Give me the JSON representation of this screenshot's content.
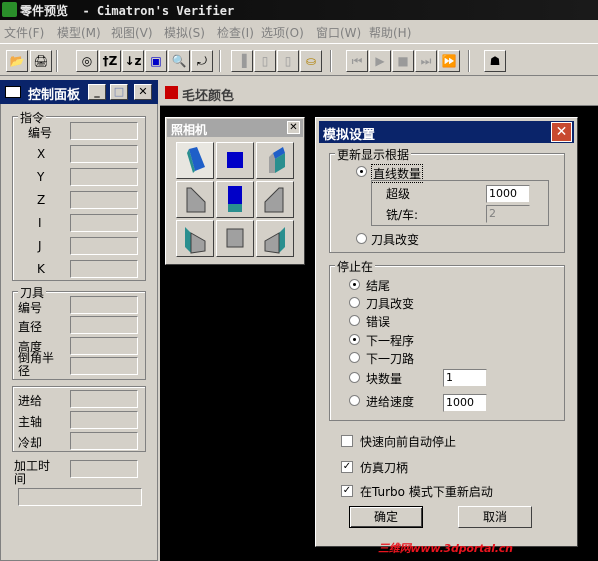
{
  "window": {
    "title": "零件预览  - Cimatron's Verifier"
  },
  "menu": [
    "文件(F)",
    "模型(M)",
    "视图(V)",
    "模拟(S)",
    "检查(I)",
    "选项(O)",
    "窗口(W)",
    "帮助(H)"
  ],
  "toolbar": {
    "buttons": [
      "open",
      "print",
      "camera",
      "zoom-t",
      "zoom-l",
      "box",
      "magnify",
      "rotate",
      "tool1",
      "tool2",
      "tool3",
      "stock",
      "rewind",
      "play",
      "stop",
      "step",
      "fast-forward",
      "robot"
    ],
    "glyphs": {
      "open": "📂",
      "print": "🖨",
      "camera": "◎",
      "zoom_t": "†Z",
      "zoom_l": "↓z",
      "box": "▣",
      "magnify": "🔍",
      "rotate": "⤾",
      "rewind": "⏮",
      "play": "▶",
      "stop": "■",
      "step": "⏭",
      "ffwd": "⏩",
      "robot": "☗"
    }
  },
  "control_panel": {
    "title": "控制面板",
    "instruction_group": {
      "label": "指令",
      "rows": [
        "编号",
        "X",
        "Y",
        "Z",
        "I",
        "J",
        "K"
      ]
    },
    "tool_group": {
      "label": "刀具",
      "rows": [
        "编号",
        "直径",
        "高度",
        "倒角半径"
      ]
    },
    "motion_group": {
      "rows": [
        "进给",
        "主轴",
        "冷却"
      ]
    },
    "time_label": "加工时间"
  },
  "workspace": {
    "title": "毛坯颜色"
  },
  "camera": {
    "title": "照相机"
  },
  "dialog": {
    "title": "模拟设置",
    "update_group": {
      "label": "更新显示根据",
      "opt_line_count": "直线数量",
      "exceed_label": "超级",
      "exceed_value": "1000",
      "mill_lathe_label": "铣/车:",
      "mill_lathe_value": "2",
      "opt_tool_change": "刀具改变"
    },
    "stop_group": {
      "label": "停止在",
      "options": [
        "结尾",
        "刀具改变",
        "错误",
        "下一程序",
        "下一刀路",
        "块数量",
        "进给速度"
      ],
      "block_count_value": "1",
      "feed_rate_value": "1000"
    },
    "checks": {
      "fast_forward_stop": "快速向前自动停止",
      "simulate_holder": "仿真刀柄",
      "turbo_restart": "在Turbo 模式下重新启动"
    },
    "ok_label": "确定",
    "cancel_label": "取消"
  },
  "watermark": "三维网www.3dportal.cn"
}
